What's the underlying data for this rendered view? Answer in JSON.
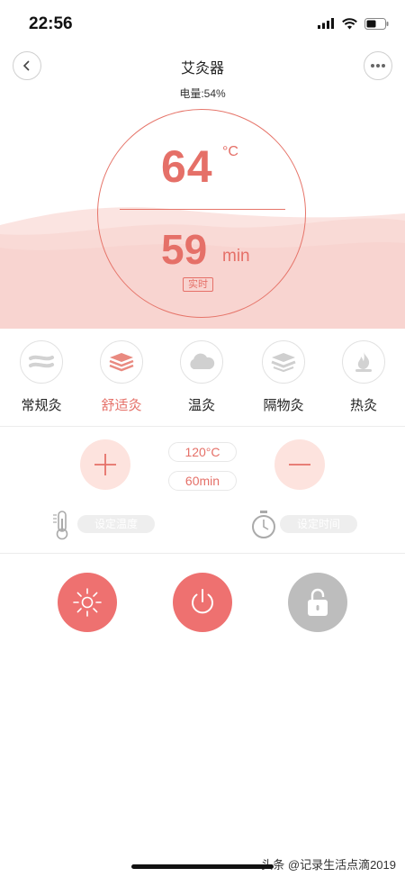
{
  "status_bar": {
    "time": "22:56"
  },
  "nav": {
    "title": "艾灸器"
  },
  "battery": {
    "text": "电量:54%"
  },
  "dial": {
    "temperature": "64",
    "temperature_unit": "°C",
    "time": "59",
    "time_unit": "min",
    "badge": "实时"
  },
  "modes": [
    {
      "label": "常规灸",
      "icon": "layers-flat-icon",
      "active": false
    },
    {
      "label": "舒适灸",
      "icon": "layers-stack-icon",
      "active": true
    },
    {
      "label": "温灸",
      "icon": "cloud-icon",
      "active": false
    },
    {
      "label": "隔物灸",
      "icon": "stack-icon",
      "active": false
    },
    {
      "label": "热灸",
      "icon": "flame-icon",
      "active": false
    }
  ],
  "controls": {
    "temperature_value": "120°C",
    "time_value": "60min",
    "set_temperature_label": "设定温度",
    "set_time_label": "设定时间"
  },
  "colors": {
    "accent": "#e57068",
    "accent_light": "#fde3de",
    "hero_wave": "#f9dcd8",
    "lock_gray": "#bdbdbd"
  },
  "watermark": {
    "text": "头条 @记录生活点滴2019"
  }
}
